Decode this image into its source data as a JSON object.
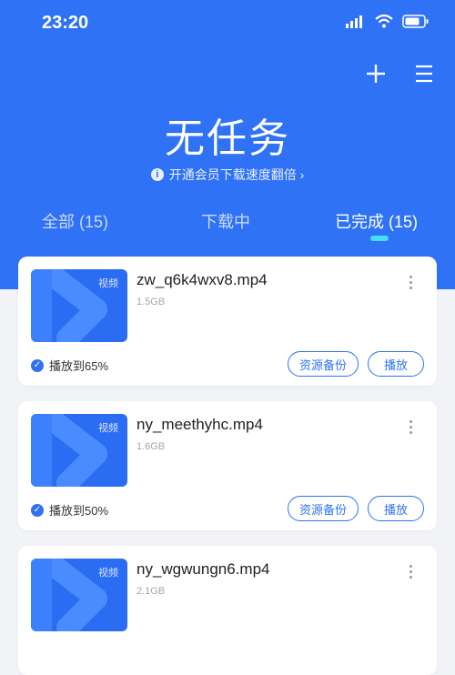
{
  "status_bar": {
    "time": "23:20"
  },
  "header": {
    "title": "无任务",
    "vip_text": "开通会员下载速度翻倍 ›",
    "info_icon": "i"
  },
  "tabs": [
    {
      "label": "全部 (15)"
    },
    {
      "label": "下载中"
    },
    {
      "label": "已完成 (15)"
    }
  ],
  "files": [
    {
      "name": "zw_q6k4wxv8.mp4",
      "size": "1.5GB",
      "tag": "视频",
      "progress_text": "播放到65%",
      "backup_label": "资源备份",
      "play_label": "播放"
    },
    {
      "name": "ny_meethyhc.mp4",
      "size": "1.6GB",
      "tag": "视频",
      "progress_text": "播放到50%",
      "backup_label": "资源备份",
      "play_label": "播放"
    },
    {
      "name": "ny_wgwungn6.mp4",
      "size": "2.1GB",
      "tag": "视频",
      "progress_text": "",
      "backup_label": "",
      "play_label": ""
    }
  ],
  "colors": {
    "accent": "#2f72f5",
    "tab_indicator": "#42e0f5"
  },
  "icons": [
    "signal-icon",
    "wifi-icon",
    "battery-icon",
    "plus-icon",
    "menu-icon",
    "info-icon",
    "more-icon",
    "check-icon",
    "play-icon"
  ]
}
